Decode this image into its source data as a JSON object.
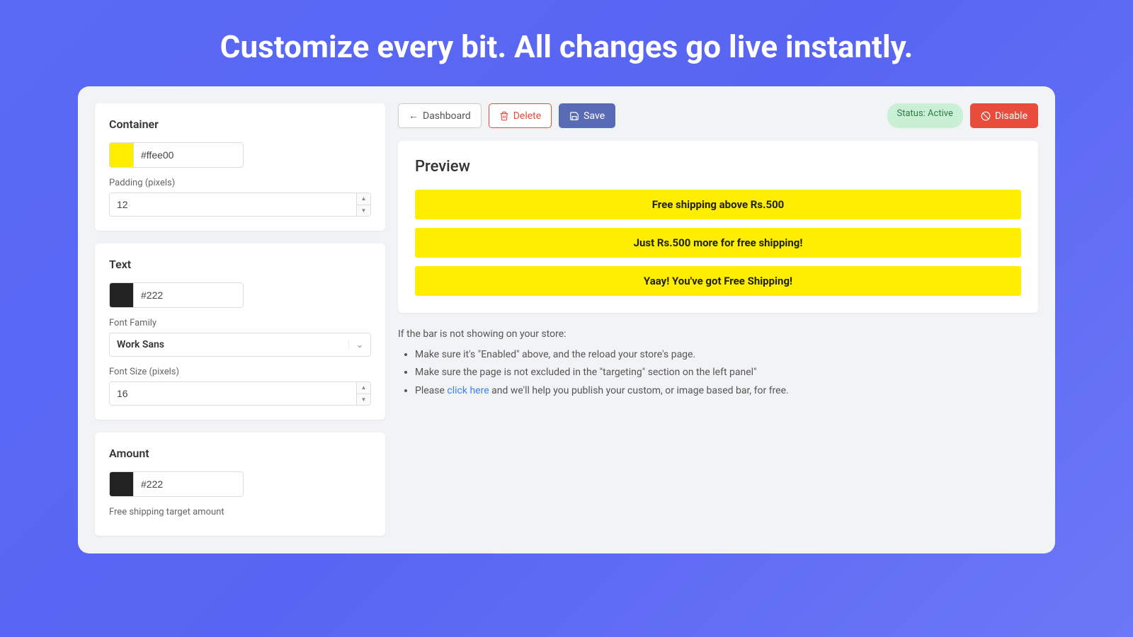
{
  "hero": {
    "title": "Customize every bit. All changes go live instantly."
  },
  "toolbar": {
    "dashboard_label": "Dashboard",
    "delete_label": "Delete",
    "save_label": "Save",
    "status_label": "Status: Active",
    "disable_label": "Disable"
  },
  "sidebar": {
    "container": {
      "title": "Container",
      "color_hex": "#ffee00",
      "swatch_color": "#ffee00",
      "padding_label": "Padding (pixels)",
      "padding_value": "12"
    },
    "text": {
      "title": "Text",
      "color_hex": "#222",
      "swatch_color": "#222222",
      "font_family_label": "Font Family",
      "font_family_value": "Work Sans",
      "font_size_label": "Font Size (pixels)",
      "font_size_value": "16"
    },
    "amount": {
      "title": "Amount",
      "color_hex": "#222",
      "swatch_color": "#222222",
      "target_label": "Free shipping target amount"
    }
  },
  "preview": {
    "title": "Preview",
    "bars": [
      "Free shipping above Rs.500",
      "Just Rs.500 more for free shipping!",
      "Yaay! You've got Free Shipping!"
    ]
  },
  "help": {
    "intro": "If the bar is not showing on your store:",
    "items": [
      "Make sure it's \"Enabled\" above, and the reload your store's page.",
      "Make sure the page is not excluded in the \"targeting\" section on the left panel\""
    ],
    "please": "Please ",
    "link": "click here",
    "after_link": " and we'll help you publish your custom, or image based bar, for free."
  }
}
